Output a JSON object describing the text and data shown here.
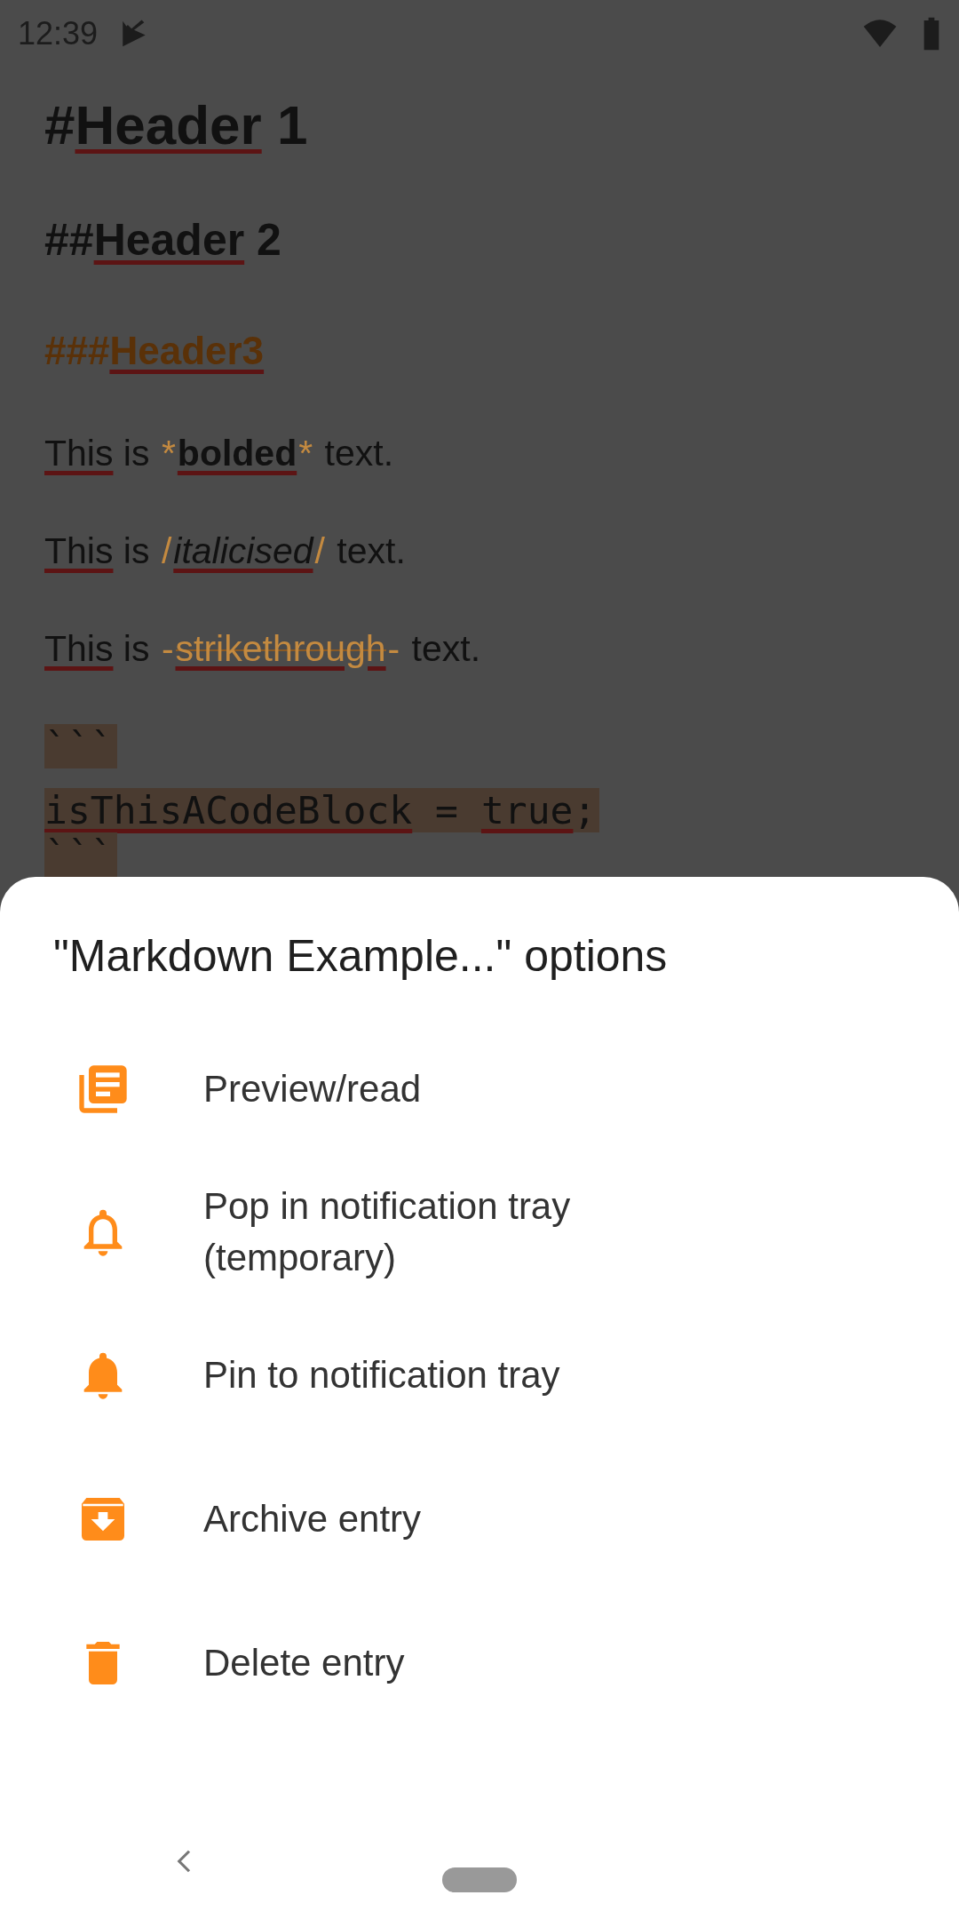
{
  "status_bar": {
    "time": "12:39"
  },
  "editor": {
    "lines": [
      {
        "kind": "h1",
        "segments": [
          {
            "text": "#"
          },
          {
            "text": "Header",
            "misspelled": true
          },
          {
            "text": " 1"
          }
        ]
      },
      {
        "kind": "h2",
        "segments": [
          {
            "text": "##"
          },
          {
            "text": "Header",
            "misspelled": true
          },
          {
            "text": " 2"
          }
        ]
      },
      {
        "kind": "h3",
        "segments": [
          {
            "text": "###"
          },
          {
            "text": "Header3",
            "misspelled": true
          }
        ]
      },
      {
        "kind": "p",
        "segments": [
          {
            "text": "This",
            "misspelled": true
          },
          {
            "text": " is "
          },
          {
            "text": "*",
            "kind": "marker"
          },
          {
            "text": "bolded",
            "kind": "bold",
            "misspelled": true
          },
          {
            "text": "*",
            "kind": "marker"
          },
          {
            "text": " text."
          }
        ]
      },
      {
        "kind": "p",
        "segments": [
          {
            "text": "This",
            "misspelled": true
          },
          {
            "text": " is "
          },
          {
            "text": "/",
            "kind": "marker"
          },
          {
            "text": "italicised",
            "kind": "italic",
            "misspelled": true
          },
          {
            "text": "/",
            "kind": "marker"
          },
          {
            "text": " text."
          }
        ]
      },
      {
        "kind": "p",
        "segments": [
          {
            "text": "This",
            "misspelled": true
          },
          {
            "text": " is "
          },
          {
            "text": "-",
            "kind": "marker"
          },
          {
            "text": "strikethrough",
            "kind": "strike",
            "misspelled": true
          },
          {
            "text": "-",
            "kind": "marker"
          },
          {
            "text": " text."
          }
        ]
      },
      {
        "kind": "code",
        "segments": [
          {
            "text": "```"
          }
        ]
      },
      {
        "kind": "code",
        "segments": [
          {
            "text": "isThisACodeBlock",
            "misspelled": true
          },
          {
            "text": " = "
          },
          {
            "text": "true",
            "misspelled": true
          },
          {
            "text": ";"
          }
        ]
      },
      {
        "kind": "code",
        "segments": [
          {
            "text": "```"
          }
        ]
      }
    ]
  },
  "sheet": {
    "title": "\"Markdown Example...\" options",
    "items": [
      {
        "kind": "library",
        "label": "Preview/read"
      },
      {
        "kind": "bell-outline",
        "label": "Pop in notification tray (temporary)"
      },
      {
        "kind": "bell",
        "label": "Pin to notification tray"
      },
      {
        "kind": "archive",
        "label": "Archive entry"
      },
      {
        "kind": "trash",
        "label": "Delete entry"
      }
    ]
  }
}
